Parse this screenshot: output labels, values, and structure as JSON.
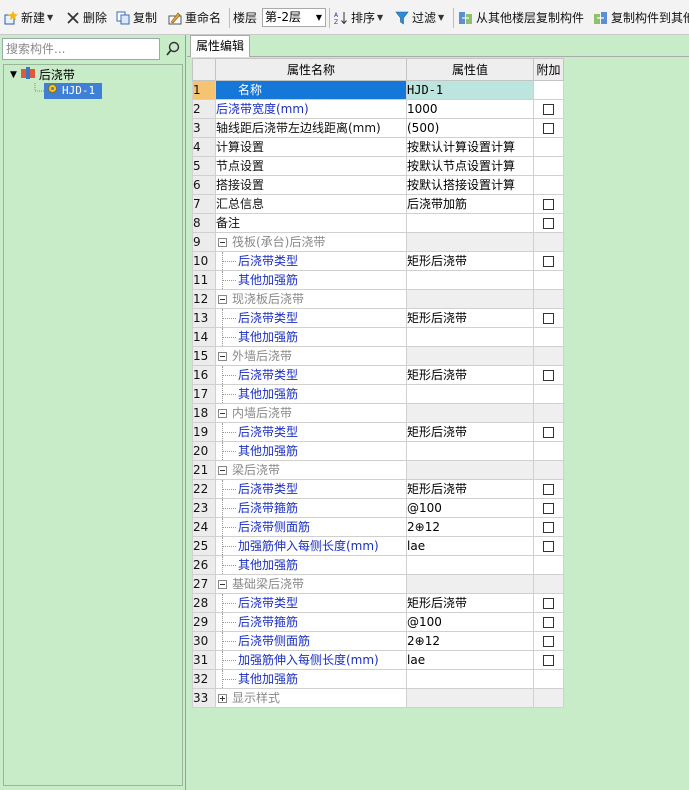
{
  "toolbar": {
    "new_label": "新建",
    "delete_label": "删除",
    "copy_label": "复制",
    "rename_label": "重命名",
    "floor_label": "楼层",
    "floor_value": "第-2层",
    "sort_label": "排序",
    "filter_label": "过滤",
    "copy_from_floor_label": "从其他楼层复制构件",
    "copy_to_floor_label": "复制构件到其他"
  },
  "left_panel": {
    "search_placeholder": "搜索构件...",
    "tree_root": "后浇带",
    "tree_child": "HJD-1"
  },
  "right_panel": {
    "tab": "属性编辑",
    "columns": {
      "name": "属性名称",
      "value": "属性值",
      "add": "附加"
    }
  },
  "rows": [
    {
      "no": "1",
      "name": "名称",
      "value": "HJD-1",
      "checkbox": false,
      "selected": true
    },
    {
      "no": "2",
      "name": "后浇带宽度(mm)",
      "value": "1000",
      "checkbox": true,
      "color": "blue"
    },
    {
      "no": "3",
      "name": "轴线距后浇带左边线距离(mm)",
      "value": "(500)",
      "checkbox": true,
      "color": "dark"
    },
    {
      "no": "4",
      "name": "计算设置",
      "value": "按默认计算设置计算",
      "checkbox": false,
      "color": "dark"
    },
    {
      "no": "5",
      "name": "节点设置",
      "value": "按默认节点设置计算",
      "checkbox": false,
      "color": "dark"
    },
    {
      "no": "6",
      "name": "搭接设置",
      "value": "按默认搭接设置计算",
      "checkbox": false,
      "color": "dark"
    },
    {
      "no": "7",
      "name": "汇总信息",
      "value": "后浇带加筋",
      "checkbox": true,
      "color": "dark"
    },
    {
      "no": "8",
      "name": "备注",
      "value": "",
      "checkbox": true,
      "color": "dark"
    },
    {
      "no": "9",
      "name": "筏板(承台)后浇带",
      "group": true,
      "expanded": true
    },
    {
      "no": "10",
      "name": "后浇带类型",
      "value": "矩形后浇带",
      "checkbox": true,
      "child": true
    },
    {
      "no": "11",
      "name": "其他加强筋",
      "value": "",
      "checkbox": false,
      "child": true
    },
    {
      "no": "12",
      "name": "现浇板后浇带",
      "group": true,
      "expanded": true
    },
    {
      "no": "13",
      "name": "后浇带类型",
      "value": "矩形后浇带",
      "checkbox": true,
      "child": true
    },
    {
      "no": "14",
      "name": "其他加强筋",
      "value": "",
      "checkbox": false,
      "child": true
    },
    {
      "no": "15",
      "name": "外墙后浇带",
      "group": true,
      "expanded": true
    },
    {
      "no": "16",
      "name": "后浇带类型",
      "value": "矩形后浇带",
      "checkbox": true,
      "child": true
    },
    {
      "no": "17",
      "name": "其他加强筋",
      "value": "",
      "checkbox": false,
      "child": true
    },
    {
      "no": "18",
      "name": "内墙后浇带",
      "group": true,
      "expanded": true
    },
    {
      "no": "19",
      "name": "后浇带类型",
      "value": "矩形后浇带",
      "checkbox": true,
      "child": true
    },
    {
      "no": "20",
      "name": "其他加强筋",
      "value": "",
      "checkbox": false,
      "child": true
    },
    {
      "no": "21",
      "name": "梁后浇带",
      "group": true,
      "expanded": true
    },
    {
      "no": "22",
      "name": "后浇带类型",
      "value": "矩形后浇带",
      "checkbox": true,
      "child": true
    },
    {
      "no": "23",
      "name": "后浇带箍筋",
      "value": "@100",
      "checkbox": true,
      "child": true
    },
    {
      "no": "24",
      "name": "后浇带侧面筋",
      "value": "2⊕12",
      "checkbox": true,
      "child": true
    },
    {
      "no": "25",
      "name": "加强筋伸入每侧长度(mm)",
      "value": "lae",
      "checkbox": true,
      "child": true
    },
    {
      "no": "26",
      "name": "其他加强筋",
      "value": "",
      "checkbox": false,
      "child": true
    },
    {
      "no": "27",
      "name": "基础梁后浇带",
      "group": true,
      "expanded": true
    },
    {
      "no": "28",
      "name": "后浇带类型",
      "value": "矩形后浇带",
      "checkbox": true,
      "child": true
    },
    {
      "no": "29",
      "name": "后浇带箍筋",
      "value": "@100",
      "checkbox": true,
      "child": true
    },
    {
      "no": "30",
      "name": "后浇带侧面筋",
      "value": "2⊕12",
      "checkbox": true,
      "child": true
    },
    {
      "no": "31",
      "name": "加强筋伸入每侧长度(mm)",
      "value": "lae",
      "checkbox": true,
      "child": true
    },
    {
      "no": "32",
      "name": "其他加强筋",
      "value": "",
      "checkbox": false,
      "child": true
    },
    {
      "no": "33",
      "name": "显示样式",
      "group": true,
      "expanded": false
    }
  ],
  "colors": {
    "background": "#c8ecc8",
    "header_highlight": "#f6c471",
    "selection": "#1578d8",
    "link_text": "#1a2fc4"
  }
}
